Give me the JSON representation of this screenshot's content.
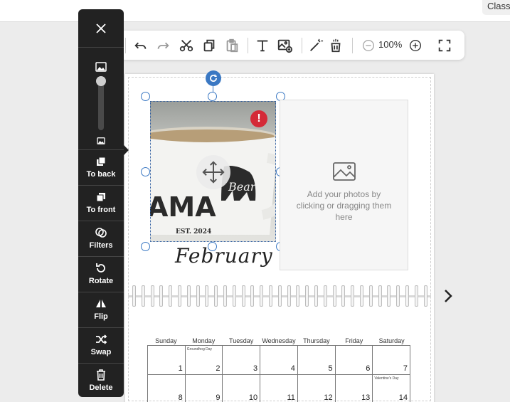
{
  "topbar": {
    "right_label": "Class"
  },
  "toolbar": {
    "zoom": "100%",
    "icons": [
      "undo-icon",
      "redo-icon",
      "cut-icon",
      "copy-icon",
      "paste-icon",
      "text-icon",
      "add-image-icon",
      "magic-wand-icon",
      "clear-page-icon",
      "zoom-out-icon",
      "zoom-in-icon",
      "fullscreen-icon"
    ]
  },
  "sidebar": {
    "buttons": [
      {
        "name": "to-back",
        "label": "To back",
        "icon": "to-back-icon"
      },
      {
        "name": "to-front",
        "label": "To front",
        "icon": "to-front-icon"
      },
      {
        "name": "filters",
        "label": "Filters",
        "icon": "filters-icon"
      },
      {
        "name": "rotate",
        "label": "Rotate",
        "icon": "rotate-icon"
      },
      {
        "name": "flip",
        "label": "Flip",
        "icon": "flip-icon"
      },
      {
        "name": "swap",
        "label": "Swap",
        "icon": "swap-icon"
      },
      {
        "name": "delete",
        "label": "Delete",
        "icon": "trash-icon"
      }
    ],
    "size_slider": 0.0
  },
  "photo": {
    "mug_text": "AMA",
    "bear_text": "Bear",
    "est_text": "EST. 2024"
  },
  "placeholder": {
    "text": "Add your photos by clicking or dragging them here"
  },
  "calendar": {
    "month": "February",
    "weekdays": [
      "Sunday",
      "Monday",
      "Tuesday",
      "Wednesday",
      "Thursday",
      "Friday",
      "Saturday"
    ],
    "weeks": [
      [
        {
          "d": "1"
        },
        {
          "d": "2",
          "note": "Groundhog Day"
        },
        {
          "d": "3"
        },
        {
          "d": "4"
        },
        {
          "d": "5"
        },
        {
          "d": "6"
        },
        {
          "d": "7"
        }
      ],
      [
        {
          "d": "8"
        },
        {
          "d": "9"
        },
        {
          "d": "10"
        },
        {
          "d": "11"
        },
        {
          "d": "12"
        },
        {
          "d": "13"
        },
        {
          "d": "14",
          "note": "Valentine's Day"
        }
      ]
    ]
  },
  "colors": {
    "accent": "#3a78c3",
    "warning": "#d42a38",
    "sidebar_bg": "#222222"
  }
}
